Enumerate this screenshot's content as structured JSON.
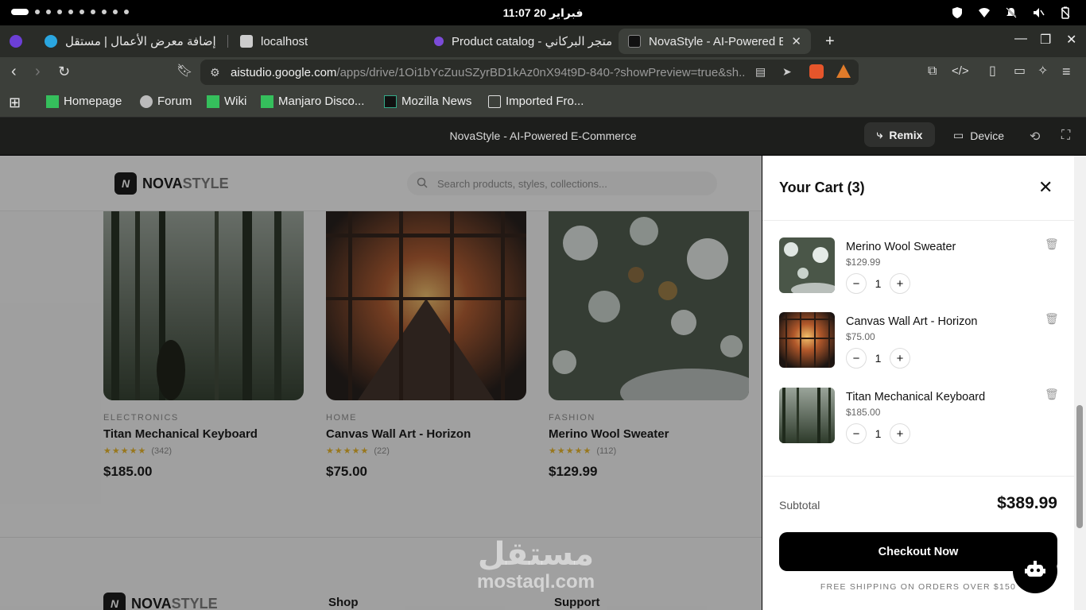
{
  "status": {
    "clock": "11:07  20 فبراير"
  },
  "tabs": [
    {
      "label": "إضافة معرض الأعمال | مستقل"
    },
    {
      "label": "localhost"
    },
    {
      "label": "Product catalog - متجر البركاني"
    },
    {
      "label": "NovaStyle - AI-Powered E"
    }
  ],
  "url": {
    "host": "aistudio.google.com",
    "path": "/apps/drive/1Oi1bYcZuuSZyrBD1kAz0nX94t9D-840-?showPreview=true&sh..."
  },
  "bookmarks": [
    {
      "label": "Homepage"
    },
    {
      "label": "Forum"
    },
    {
      "label": "Wiki"
    },
    {
      "label": "Manjaro Disco..."
    },
    {
      "label": "Mozilla News"
    },
    {
      "label": "Imported Fro..."
    }
  ],
  "app_header": {
    "title": "NovaStyle - AI-Powered E-Commerce",
    "remix": "Remix",
    "device": "Device"
  },
  "site": {
    "logo_bold": "NOVA",
    "logo_light": "STYLE",
    "logo_mark": "N",
    "search_placeholder": "Search products, styles, collections...",
    "products": [
      {
        "category": "ELECTRONICS",
        "name": "Titan Mechanical Keyboard",
        "reviews": "(342)",
        "price": "$185.00"
      },
      {
        "category": "HOME",
        "name": "Canvas Wall Art - Horizon",
        "reviews": "(22)",
        "price": "$75.00"
      },
      {
        "category": "FASHION",
        "name": "Merino Wool Sweater",
        "reviews": "(112)",
        "price": "$129.99"
      }
    ],
    "footer": {
      "shop": "Shop",
      "support": "Support"
    }
  },
  "watermark": {
    "arabic": "مستقل",
    "latin": "mostaql.com"
  },
  "cart": {
    "title": "Your Cart (3)",
    "items": [
      {
        "name": "Merino Wool Sweater",
        "price": "$129.99",
        "qty": "1"
      },
      {
        "name": "Canvas Wall Art - Horizon",
        "price": "$75.00",
        "qty": "1"
      },
      {
        "name": "Titan Mechanical Keyboard",
        "price": "$185.00",
        "qty": "1"
      }
    ],
    "subtotal_label": "Subtotal",
    "subtotal_value": "$389.99",
    "checkout_label": "Checkout Now",
    "shipping_note": "FREE SHIPPING ON ORDERS OVER $150"
  },
  "colors": {
    "accent": "#000000",
    "star": "#e8b422",
    "browser_chrome": "#3c3f3a"
  }
}
